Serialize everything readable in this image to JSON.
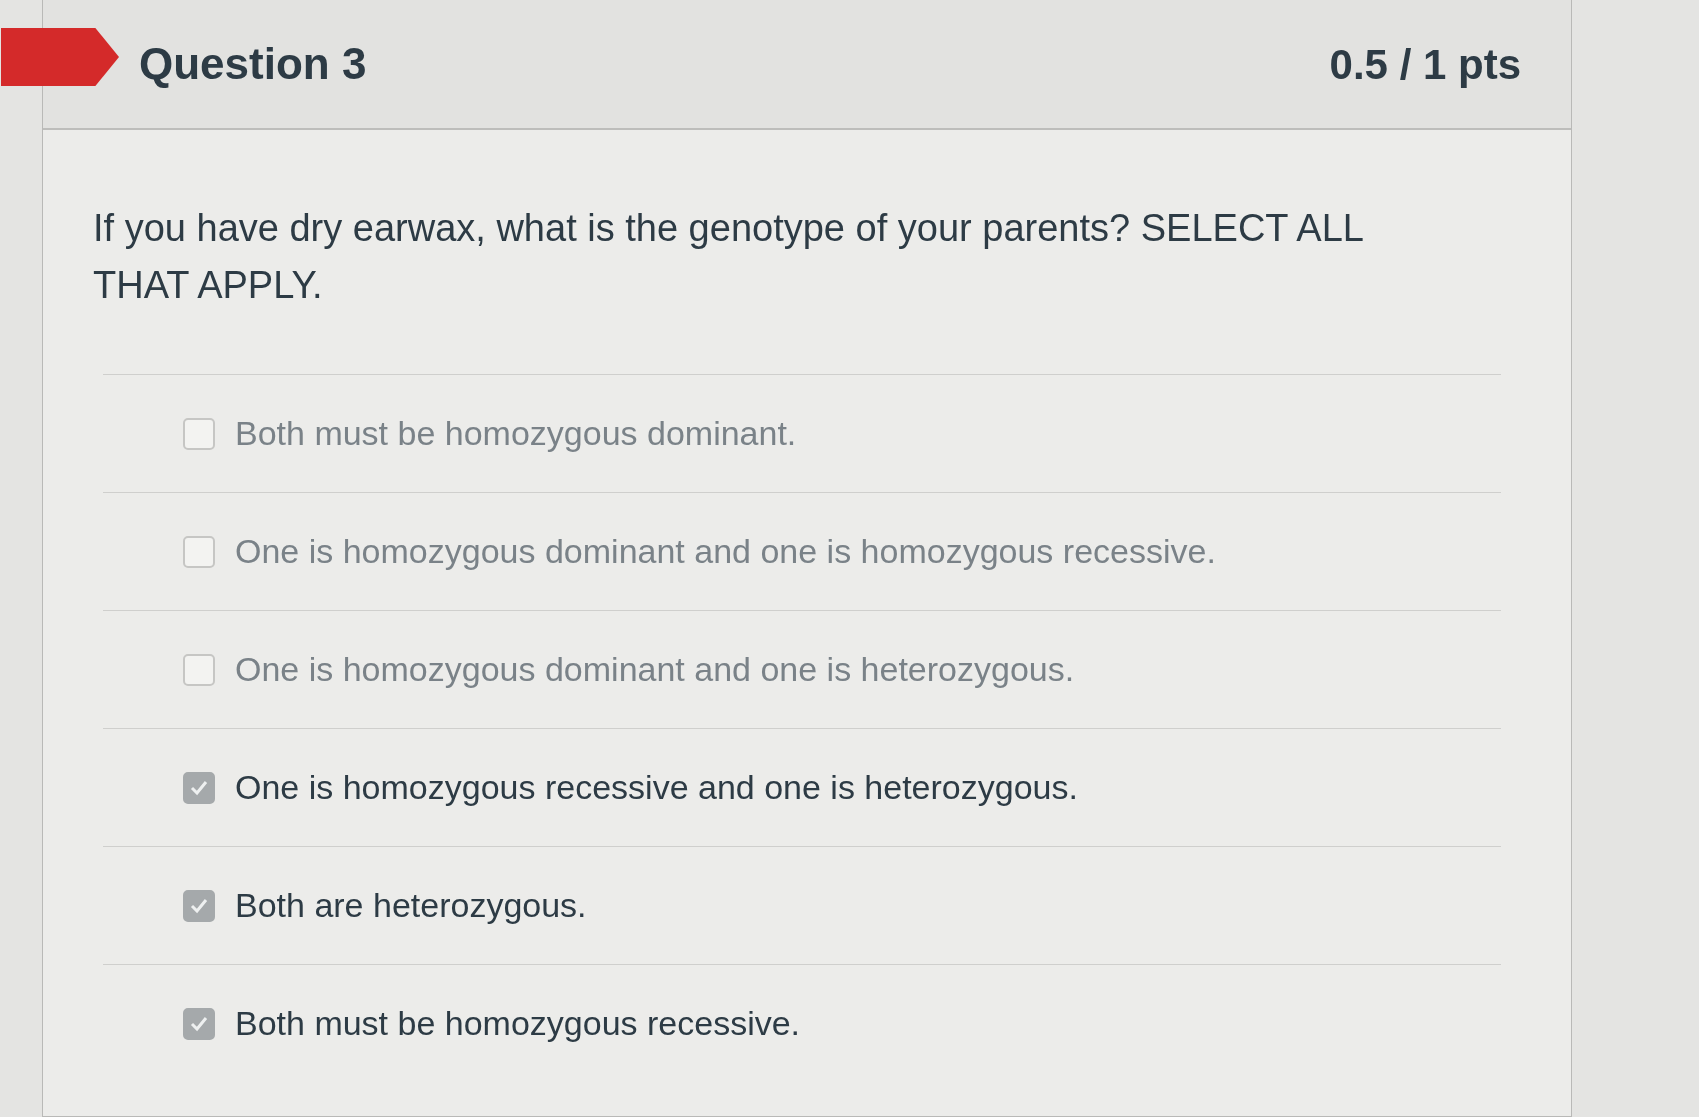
{
  "header": {
    "title": "Question 3",
    "points": "0.5 / 1 pts"
  },
  "question": "If you have dry earwax, what is the genotype of your parents? SELECT ALL THAT APPLY.",
  "answers": [
    {
      "label": "Both must be homozygous dominant.",
      "checked": false
    },
    {
      "label": "One is homozygous dominant and one is homozygous recessive.",
      "checked": false
    },
    {
      "label": "One is homozygous dominant and one is heterozygous.",
      "checked": false
    },
    {
      "label": "One is homozygous recessive and one is heterozygous.",
      "checked": true
    },
    {
      "label": "Both are heterozygous.",
      "checked": true
    },
    {
      "label": "Both must be homozygous recessive.",
      "checked": true
    }
  ]
}
